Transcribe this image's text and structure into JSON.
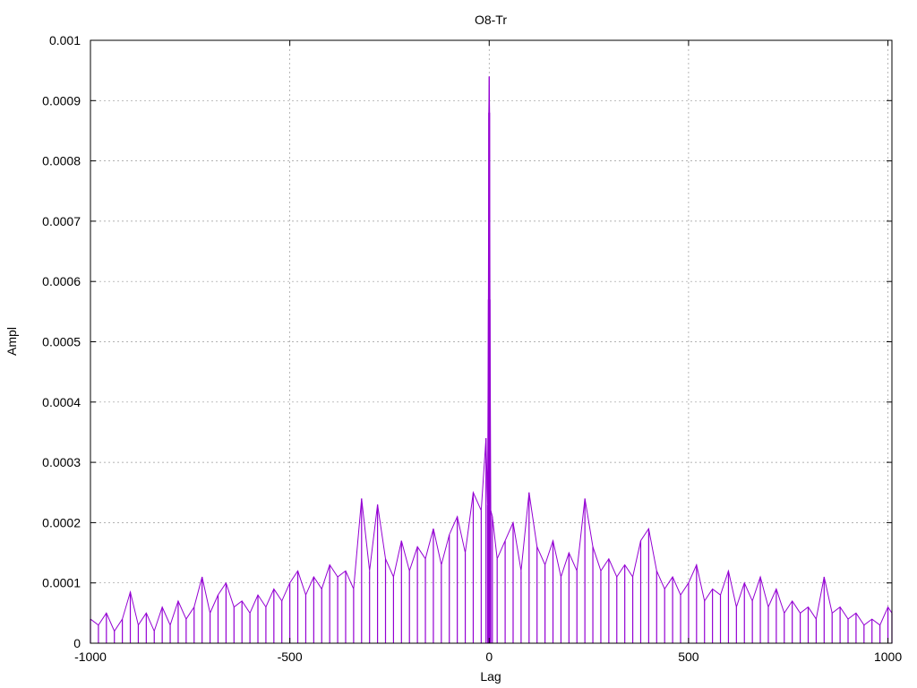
{
  "chart_data": {
    "type": "line",
    "title": "O8-Tr",
    "xlabel": "Lag",
    "ylabel": "Ampl",
    "xlim": [
      -1000,
      1010
    ],
    "ylim": [
      0,
      0.001
    ],
    "x_ticks": [
      -1000,
      -500,
      0,
      500,
      1000
    ],
    "x_tick_labels": [
      "-1000",
      "-500",
      "0",
      "500",
      "1000"
    ],
    "y_ticks": [
      0,
      0.0001,
      0.0002,
      0.0003,
      0.0004,
      0.0005,
      0.0006,
      0.0007,
      0.0008,
      0.0009,
      0.001
    ],
    "y_tick_labels": [
      "0",
      "0.0001",
      "0.0002",
      "0.0003",
      "0.0004",
      "0.0005",
      "0.0006",
      "0.0007",
      "0.0008",
      "0.0009",
      "0.001"
    ],
    "grid": true,
    "line_color": "#9400d3",
    "series": [
      {
        "x": [
          -1000,
          -980,
          -960,
          -940,
          -920,
          -900,
          -880,
          -860,
          -840,
          -820,
          -800,
          -780,
          -760,
          -740,
          -720,
          -700,
          -680,
          -660,
          -640,
          -620,
          -600,
          -580,
          -560,
          -540,
          -520,
          -500,
          -480,
          -460,
          -440,
          -420,
          -400,
          -380,
          -360,
          -340,
          -320,
          -300,
          -280,
          -260,
          -240,
          -220,
          -200,
          -180,
          -160,
          -140,
          -120,
          -100,
          -80,
          -60,
          -40,
          -20,
          -8,
          -4,
          -2,
          -1,
          0,
          1,
          2,
          4,
          8,
          20,
          40,
          60,
          80,
          100,
          120,
          140,
          160,
          180,
          200,
          220,
          240,
          260,
          280,
          300,
          320,
          340,
          360,
          380,
          400,
          420,
          440,
          460,
          480,
          500,
          520,
          540,
          560,
          580,
          600,
          620,
          640,
          660,
          680,
          700,
          720,
          740,
          760,
          780,
          800,
          820,
          840,
          860,
          880,
          900,
          920,
          940,
          960,
          980,
          1000,
          1010
        ],
        "y": [
          4e-05,
          3e-05,
          5e-05,
          2e-05,
          4e-05,
          8.5e-05,
          3e-05,
          5e-05,
          2e-05,
          6e-05,
          3e-05,
          7e-05,
          4e-05,
          6e-05,
          0.00011,
          5e-05,
          8e-05,
          0.0001,
          6e-05,
          7e-05,
          5e-05,
          8e-05,
          6e-05,
          9e-05,
          7e-05,
          0.0001,
          0.00012,
          8e-05,
          0.00011,
          9e-05,
          0.00013,
          0.00011,
          0.00012,
          9e-05,
          0.00024,
          0.00012,
          0.00023,
          0.00014,
          0.00011,
          0.00017,
          0.00012,
          0.00016,
          0.00014,
          0.00019,
          0.00013,
          0.00018,
          0.00021,
          0.00015,
          0.00025,
          0.00022,
          0.00034,
          0.00023,
          0.00057,
          0.00088,
          0.00094,
          0.00088,
          0.00057,
          0.00022,
          0.00021,
          0.00014,
          0.00017,
          0.0002,
          0.00012,
          0.00025,
          0.00016,
          0.00013,
          0.00017,
          0.00011,
          0.00015,
          0.00012,
          0.00024,
          0.00016,
          0.00012,
          0.00014,
          0.00011,
          0.00013,
          0.00011,
          0.00017,
          0.00019,
          0.00012,
          9e-05,
          0.00011,
          8e-05,
          0.0001,
          0.00013,
          7e-05,
          9e-05,
          8e-05,
          0.00012,
          6e-05,
          0.0001,
          7e-05,
          0.00011,
          6e-05,
          9e-05,
          5e-05,
          7e-05,
          5e-05,
          6e-05,
          4e-05,
          0.00011,
          5e-05,
          6e-05,
          4e-05,
          5e-05,
          3e-05,
          4e-05,
          3e-05,
          6e-05,
          5e-05
        ]
      }
    ]
  }
}
